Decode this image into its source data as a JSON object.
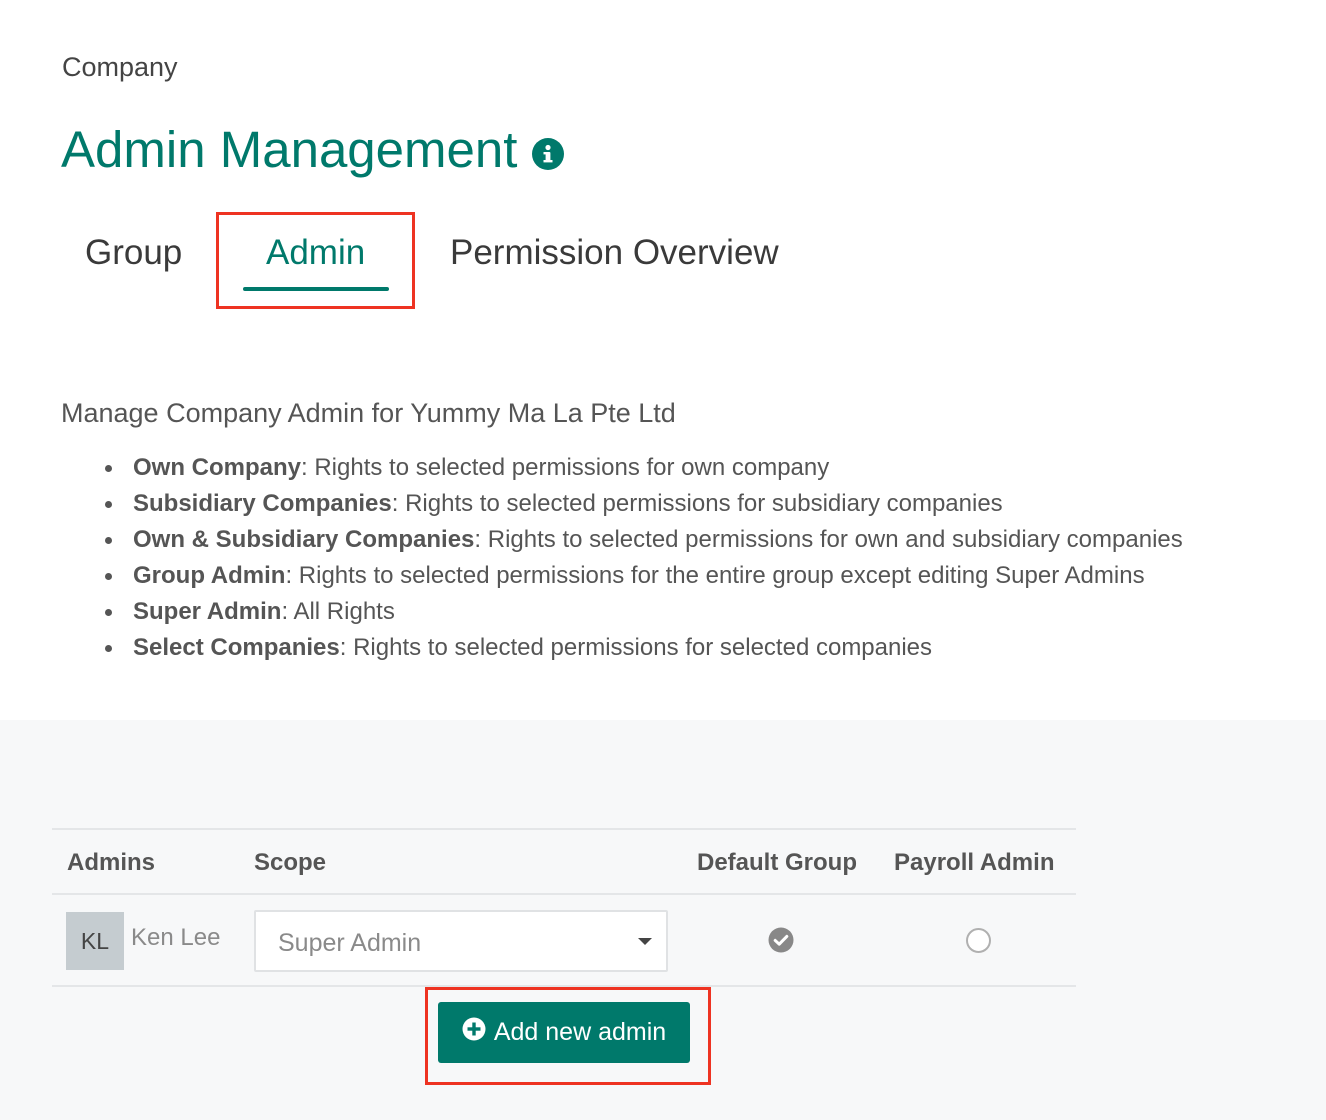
{
  "breadcrumb": "Company",
  "page": {
    "title": "Admin Management",
    "info_icon": "info-circle-icon"
  },
  "tabs": [
    {
      "label": "Group",
      "active": false
    },
    {
      "label": "Admin",
      "active": true
    },
    {
      "label": "Permission Overview",
      "active": false
    }
  ],
  "description": "Manage Company Admin for Yummy Ma La Pte Ltd",
  "scope_rules": [
    {
      "term": "Own Company",
      "text": ": Rights to selected permissions for own company"
    },
    {
      "term": "Subsidiary Companies",
      "text": ": Rights to selected permissions for subsidiary companies"
    },
    {
      "term": "Own & Subsidiary Companies",
      "text": ": Rights to selected permissions for own and subsidiary companies"
    },
    {
      "term": "Group Admin",
      "text": ": Rights to selected permissions for the entire group except editing Super Admins"
    },
    {
      "term": "Super Admin",
      "text": ": All Rights"
    },
    {
      "term": "Select Companies",
      "text": ": Rights to selected permissions for selected companies"
    }
  ],
  "table": {
    "headers": {
      "admins": "Admins",
      "scope": "Scope",
      "default_group": "Default Group",
      "payroll_admin": "Payroll Admin"
    },
    "rows": [
      {
        "initials": "KL",
        "name": "Ken Lee",
        "scope": "Super Admin",
        "default_group": true,
        "payroll_admin": false
      }
    ]
  },
  "add_button": {
    "label": "Add new admin",
    "icon": "plus-circle-icon"
  },
  "colors": {
    "accent": "#00796b",
    "highlight": "#ee3322",
    "text": "#555555",
    "panel_bg": "#f7f8f9"
  }
}
